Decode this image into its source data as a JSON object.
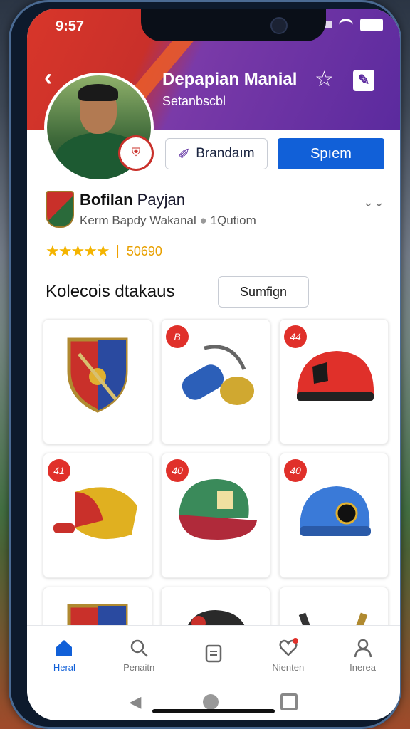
{
  "status_bar": {
    "time": "9:57"
  },
  "header": {
    "back_icon": "back-chevron-icon",
    "title": "Depapian Manial",
    "subtitle": "Setanbscbl",
    "star_icon": "star-outline-icon",
    "edit_icon": "edit-icon"
  },
  "profile": {
    "follow_button": "Brandaım",
    "primary_button": "Spıem",
    "name_bold": "Bofilan",
    "name_rest": " Payjan",
    "meta": "Kerm Bapdy Wakanal",
    "meta_count": "1Qutiom",
    "rating_stars": "★★★★★",
    "rating_value": "50690"
  },
  "collection": {
    "title": "Kolecois dtakaus",
    "filter_button": "Sumfign",
    "items": [
      {
        "badge": "",
        "name": "crest-shield"
      },
      {
        "badge": "B",
        "name": "gloves-cuffs"
      },
      {
        "badge": "44",
        "name": "red-cap"
      },
      {
        "badge": "41",
        "name": "red-yellow-hat"
      },
      {
        "badge": "40",
        "name": "green-red-cap"
      },
      {
        "badge": "40",
        "name": "blue-cap"
      },
      {
        "badge": "",
        "name": "crest-shield-2"
      },
      {
        "badge": "",
        "name": "dark-cap"
      },
      {
        "badge": "",
        "name": "tools"
      }
    ]
  },
  "bottom_nav": [
    {
      "label": "Heral",
      "icon": "home-icon",
      "active": true
    },
    {
      "label": "Penaitn",
      "icon": "search-icon",
      "active": false
    },
    {
      "label": "",
      "icon": "clipboard-icon",
      "active": false
    },
    {
      "label": "Nienten",
      "icon": "chat-heart-icon",
      "active": false
    },
    {
      "label": "Inerea",
      "icon": "person-icon",
      "active": false
    }
  ],
  "colors": {
    "brand_blue": "#1160d8",
    "header_red": "#c9302a",
    "header_purple": "#5b2a9e",
    "badge_red": "#e0302a",
    "star_gold": "#f4b400"
  }
}
